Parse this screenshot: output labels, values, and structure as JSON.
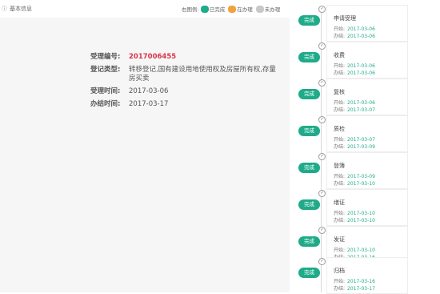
{
  "header": {
    "title": "基本信息",
    "legend_label": "右图例:",
    "legend": [
      {
        "label": "已完成",
        "color": "#1fab89"
      },
      {
        "label": "在办理",
        "color": "#f2a13c"
      },
      {
        "label": "未办理",
        "color": "#c8c8c8"
      }
    ]
  },
  "details": [
    {
      "key": "受理编号:",
      "value": "2017006455"
    },
    {
      "key": "登记类型:",
      "value": "转移登记,国有建设用地使用权及房屋所有权,存量房买卖"
    },
    {
      "key": "受理时间:",
      "value": "2017-03-06"
    },
    {
      "key": "办结时间:",
      "value": "2017-03-17"
    }
  ],
  "timeline": {
    "button_label": "完成",
    "start_label": "开始:",
    "end_label": "办结:",
    "steps": [
      {
        "title": "申请受理",
        "start": "2017-03-06",
        "end": "2017-03-06"
      },
      {
        "title": "收费",
        "start": "2017-03-06",
        "end": "2017-03-06"
      },
      {
        "title": "复核",
        "start": "2017-03-06",
        "end": "2017-03-07"
      },
      {
        "title": "质检",
        "start": "2017-03-07",
        "end": "2017-03-09"
      },
      {
        "title": "登簿",
        "start": "2017-03-09",
        "end": "2017-03-10"
      },
      {
        "title": "缮证",
        "start": "2017-03-10",
        "end": "2017-03-10"
      },
      {
        "title": "发证",
        "start": "2017-03-10",
        "end": "2017-03-16"
      },
      {
        "title": "归档",
        "start": "2017-03-16",
        "end": "2017-03-17"
      }
    ]
  }
}
